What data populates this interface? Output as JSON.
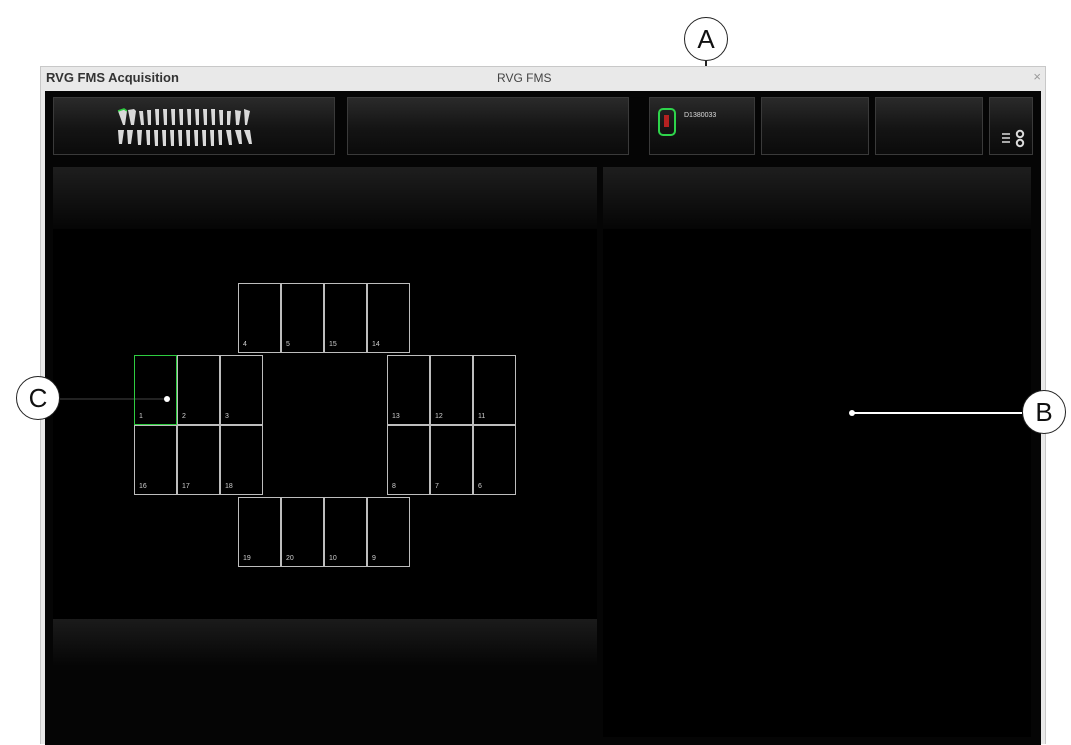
{
  "callouts": {
    "a": "A",
    "b": "B",
    "c": "C"
  },
  "window": {
    "title": "RVG FMS Acquisition",
    "center_title": "RVG FMS",
    "close_symbol": "×"
  },
  "toolbar": {
    "teeth_icon": "dental-arch-icon",
    "device": {
      "icon": "sensor-icon",
      "label": "D1380033"
    },
    "settings_icon": "settings-icon"
  },
  "slots": {
    "top": [
      "4",
      "5",
      "15",
      "14"
    ],
    "left_upper": [
      "1",
      "2",
      "3"
    ],
    "left_lower": [
      "16",
      "17",
      "18"
    ],
    "right_upper": [
      "13",
      "12",
      "11"
    ],
    "right_lower": [
      "8",
      "7",
      "6"
    ],
    "bottom": [
      "19",
      "20",
      "10",
      "9"
    ]
  },
  "colors": {
    "selected": "#2ecc40",
    "device_frame": "#2ed44b",
    "background": "#050505"
  }
}
